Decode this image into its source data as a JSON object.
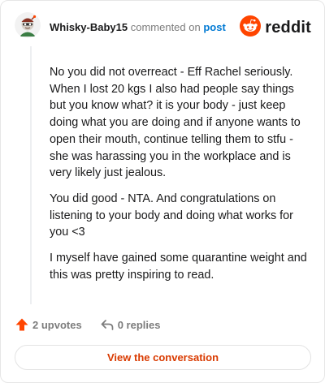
{
  "header": {
    "username": "Whisky-Baby15",
    "commented_text": "commented on",
    "post_link": "post",
    "brand": "reddit"
  },
  "comment": {
    "paragraphs": [
      "No you did not overreact - Eff Rachel seriously. When I lost 20 kgs I also had people say things but you know what? it is your body - just keep doing what you are doing and if anyone wants to open their mouth, continue telling them to stfu - she was harassing you in the workplace and is very likely just jealous.",
      "You did good - NTA. And congratulations on listening to your body and doing what works for you <3",
      "I myself have gained some quarantine weight and this was pretty inspiring to read."
    ]
  },
  "actions": {
    "upvotes": "2 upvotes",
    "replies": "0 replies"
  },
  "cta": {
    "label": "View the conversation"
  },
  "colors": {
    "brand_orange": "#ff4500",
    "link_blue": "#0079d3",
    "cta_text": "#d93a00",
    "muted": "#7c7c7c"
  }
}
